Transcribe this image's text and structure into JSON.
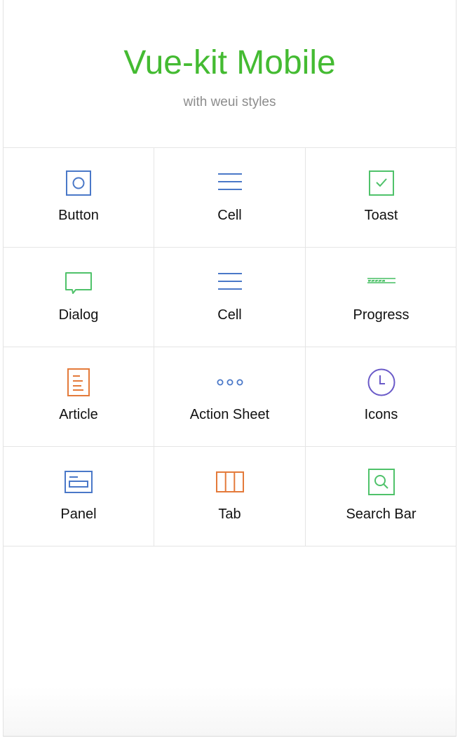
{
  "header": {
    "title": "Vue-kit Mobile",
    "subtitle": "with weui styles"
  },
  "colors": {
    "title": "#44bb32",
    "blue": "#4a78c8",
    "green": "#4fc26a",
    "orange": "#e47a3a",
    "purple": "#6a5ac8"
  },
  "grid": {
    "items": [
      {
        "label": "Button",
        "icon": "button-icon"
      },
      {
        "label": "Cell",
        "icon": "cell-icon"
      },
      {
        "label": "Toast",
        "icon": "toast-icon"
      },
      {
        "label": "Dialog",
        "icon": "dialog-icon"
      },
      {
        "label": "Cell",
        "icon": "cell-icon"
      },
      {
        "label": "Progress",
        "icon": "progress-icon"
      },
      {
        "label": "Article",
        "icon": "article-icon"
      },
      {
        "label": "Action Sheet",
        "icon": "action-sheet-icon"
      },
      {
        "label": "Icons",
        "icon": "icons-icon"
      },
      {
        "label": "Panel",
        "icon": "panel-icon"
      },
      {
        "label": "Tab",
        "icon": "tab-icon"
      },
      {
        "label": "Search Bar",
        "icon": "search-bar-icon"
      }
    ]
  }
}
